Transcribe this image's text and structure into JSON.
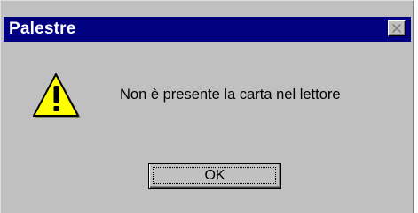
{
  "window": {
    "title": "Palestre",
    "close_icon": "close-icon"
  },
  "dialog": {
    "icon": "warning-icon",
    "message": "Non è presente la carta nel lettore",
    "ok_label": "OK"
  },
  "colors": {
    "titlebar": "#000080",
    "face": "#c0c0c0",
    "warning_fill": "#ffff00"
  }
}
